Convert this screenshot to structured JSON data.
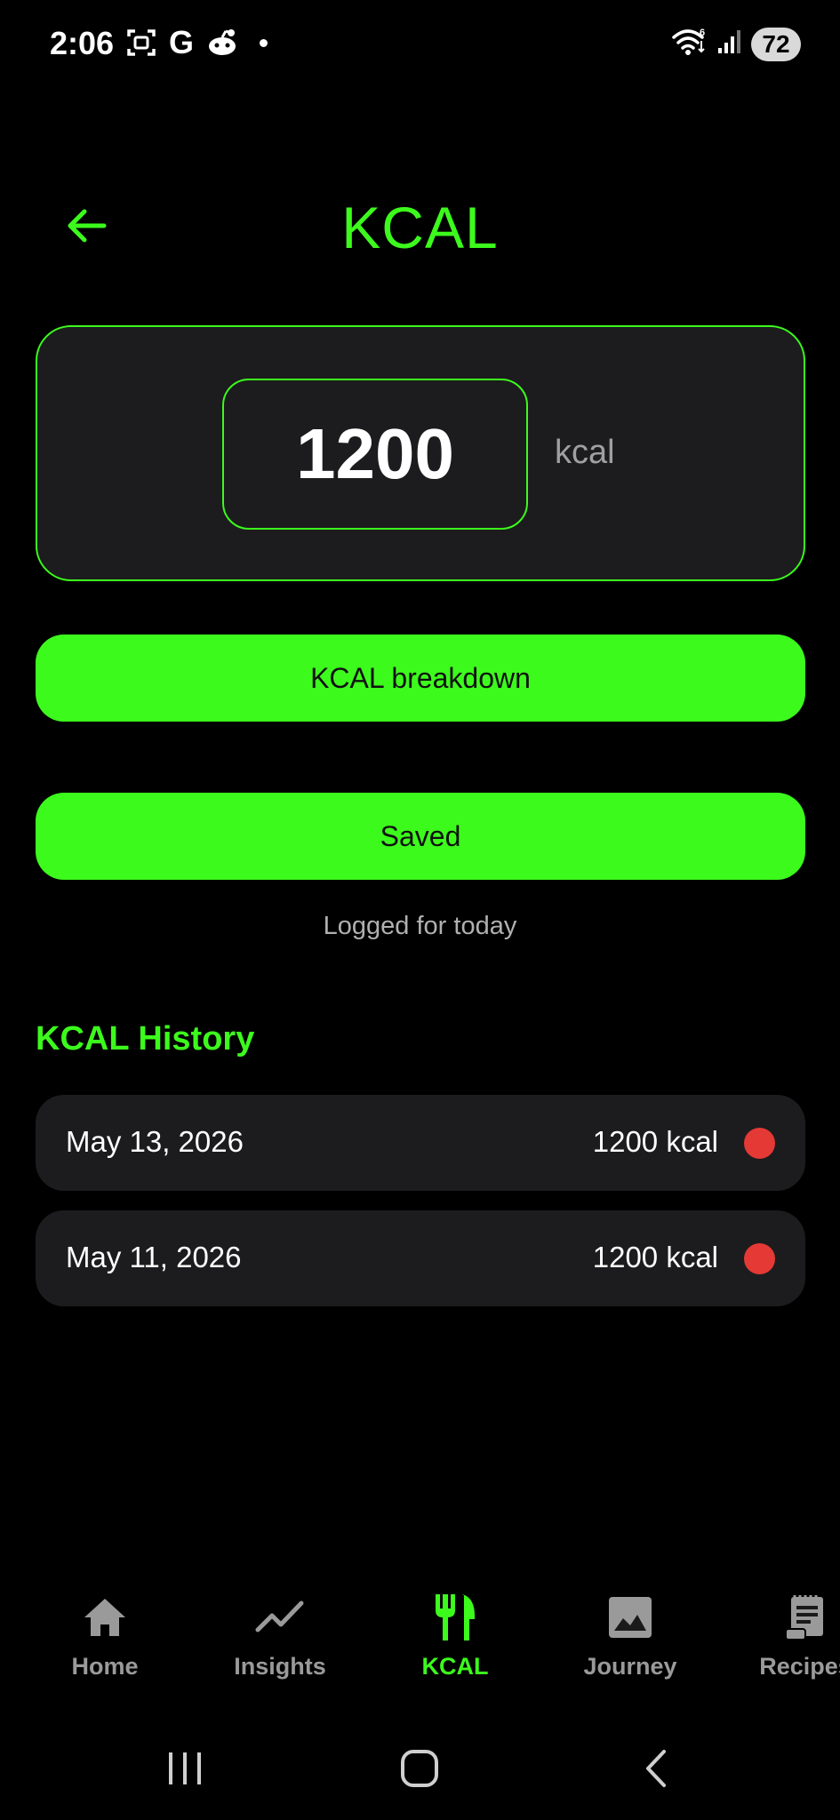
{
  "status_bar": {
    "time": "2:06",
    "g_label": "G",
    "battery": "72",
    "icons": [
      "screenshot-icon",
      "google-icon",
      "reddit-icon",
      "notification-dot",
      "wifi-icon",
      "signal-icon",
      "battery-icon"
    ]
  },
  "header": {
    "title": "KCAL",
    "back_icon": "arrow-left-icon"
  },
  "input": {
    "value": "1200",
    "unit": "kcal"
  },
  "buttons": {
    "breakdown_label": "KCAL breakdown",
    "saved_label": "Saved"
  },
  "logged_note": "Logged for today",
  "history": {
    "title": "KCAL History",
    "rows": [
      {
        "date": "May 13, 2026",
        "value": "1200 kcal",
        "status_color": "#e53935"
      },
      {
        "date": "May 11, 2026",
        "value": "1200 kcal",
        "status_color": "#e53935"
      }
    ]
  },
  "bottom_nav": {
    "items": [
      {
        "label": "Home",
        "icon": "home-icon",
        "active": false
      },
      {
        "label": "Insights",
        "icon": "trend-icon",
        "active": false
      },
      {
        "label": "KCAL",
        "icon": "fork-knife-icon",
        "active": true
      },
      {
        "label": "Journey",
        "icon": "image-icon",
        "active": false
      },
      {
        "label": "Recipes",
        "icon": "recipe-icon",
        "active": false
      }
    ]
  },
  "colors": {
    "accent": "#3cfb1c",
    "background": "#000000",
    "card": "#1c1c1e",
    "status_dot": "#e53935",
    "inactive_nav": "#9a9a9a"
  }
}
